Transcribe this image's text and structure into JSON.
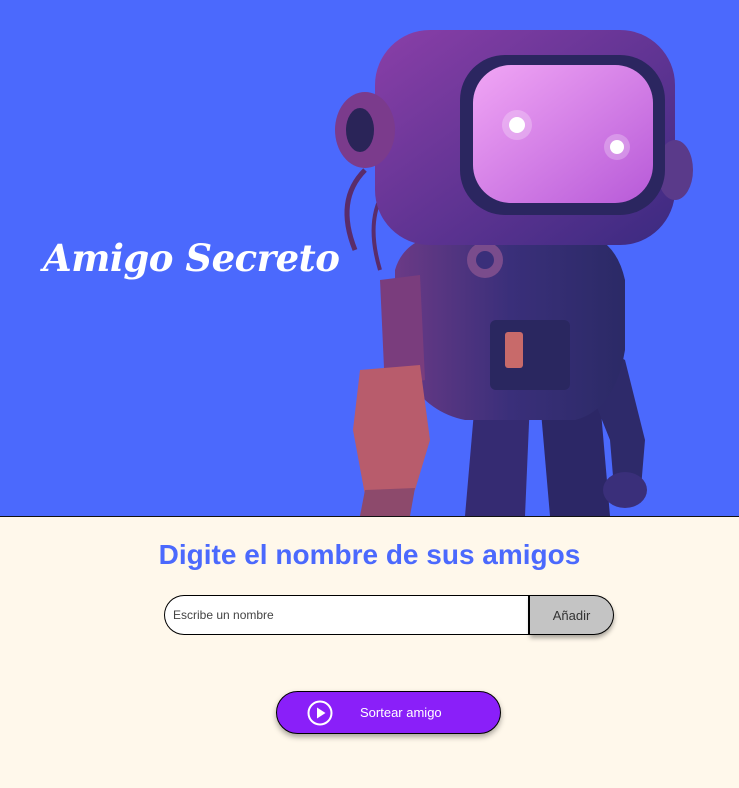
{
  "header": {
    "title": "Amigo Secreto",
    "background_color": "#4B69FD",
    "illustration": "astronaut-robot-illustration"
  },
  "main": {
    "section_title": "Digite el nombre de sus amigos",
    "name_input": {
      "placeholder": "Escribe un nombre",
      "value": ""
    },
    "add_button_label": "Añadir",
    "draw_button": {
      "label": "Sortear amigo",
      "icon": "play-circle-icon",
      "color": "#8A1FF9"
    },
    "background_color": "#FFF8EB",
    "accent_color": "#4B69FD"
  }
}
